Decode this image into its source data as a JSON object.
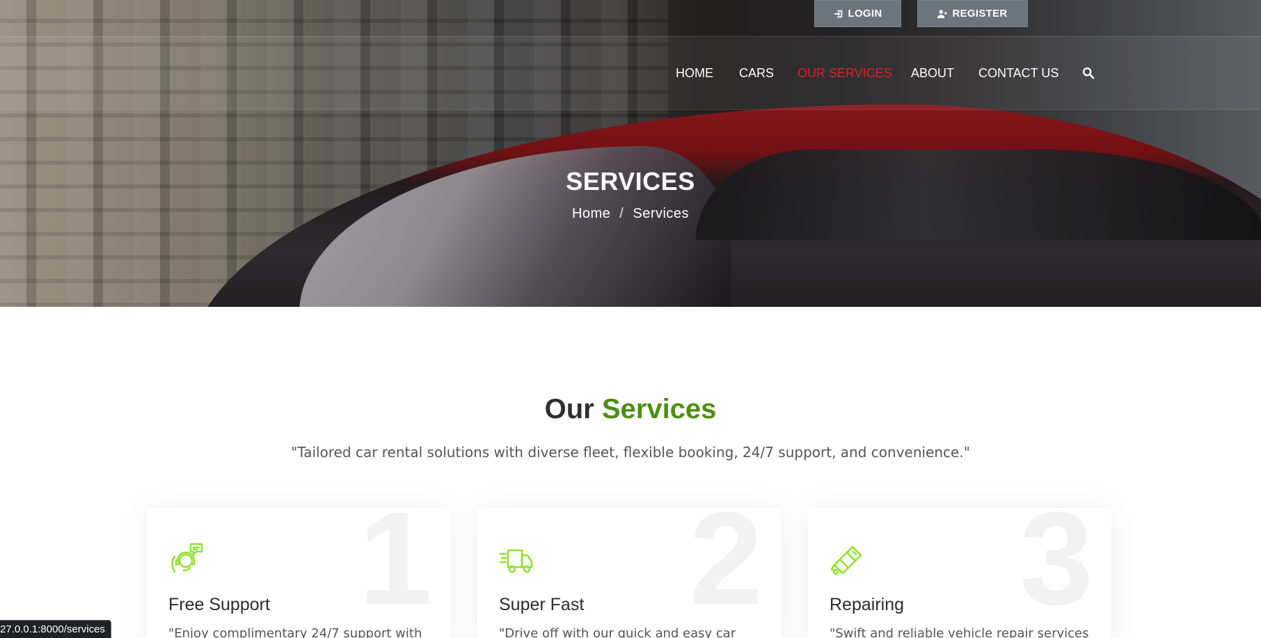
{
  "top_buttons": {
    "login": "LOGIN",
    "register": "REGISTER"
  },
  "nav": {
    "items": [
      "HOME",
      "CARS",
      "OUR SERVICES",
      "ABOUT",
      "CONTACT US"
    ],
    "active": "OUR SERVICES",
    "active_color": "#dc1f2b",
    "search_icon": "search-icon"
  },
  "hero": {
    "title": "SERVICES",
    "breadcrumb": {
      "home": "Home",
      "separator": "/",
      "current": "Services"
    }
  },
  "section": {
    "title_main": "Our",
    "title_accent": "Services",
    "accent_color": "#4e8e12",
    "subtitle": "\"Tailored car rental solutions with diverse fleet, flexible booking, 24/7 support, and convenience.\""
  },
  "cards": [
    {
      "number": "1",
      "icon": "support-agent-icon",
      "title": "Free Support",
      "text": "\"Enjoy complimentary 24/7 support with"
    },
    {
      "number": "2",
      "icon": "fast-truck-icon",
      "title": "Super Fast",
      "text": "\"Drive off with our quick and easy car"
    },
    {
      "number": "3",
      "icon": "spark-plug-icon",
      "title": "Repairing",
      "text": "\"Swift and reliable vehicle repair services"
    }
  ],
  "icon_color": "#8fe12c",
  "status_bar": {
    "url": "27.0.0.1:8000/services"
  }
}
